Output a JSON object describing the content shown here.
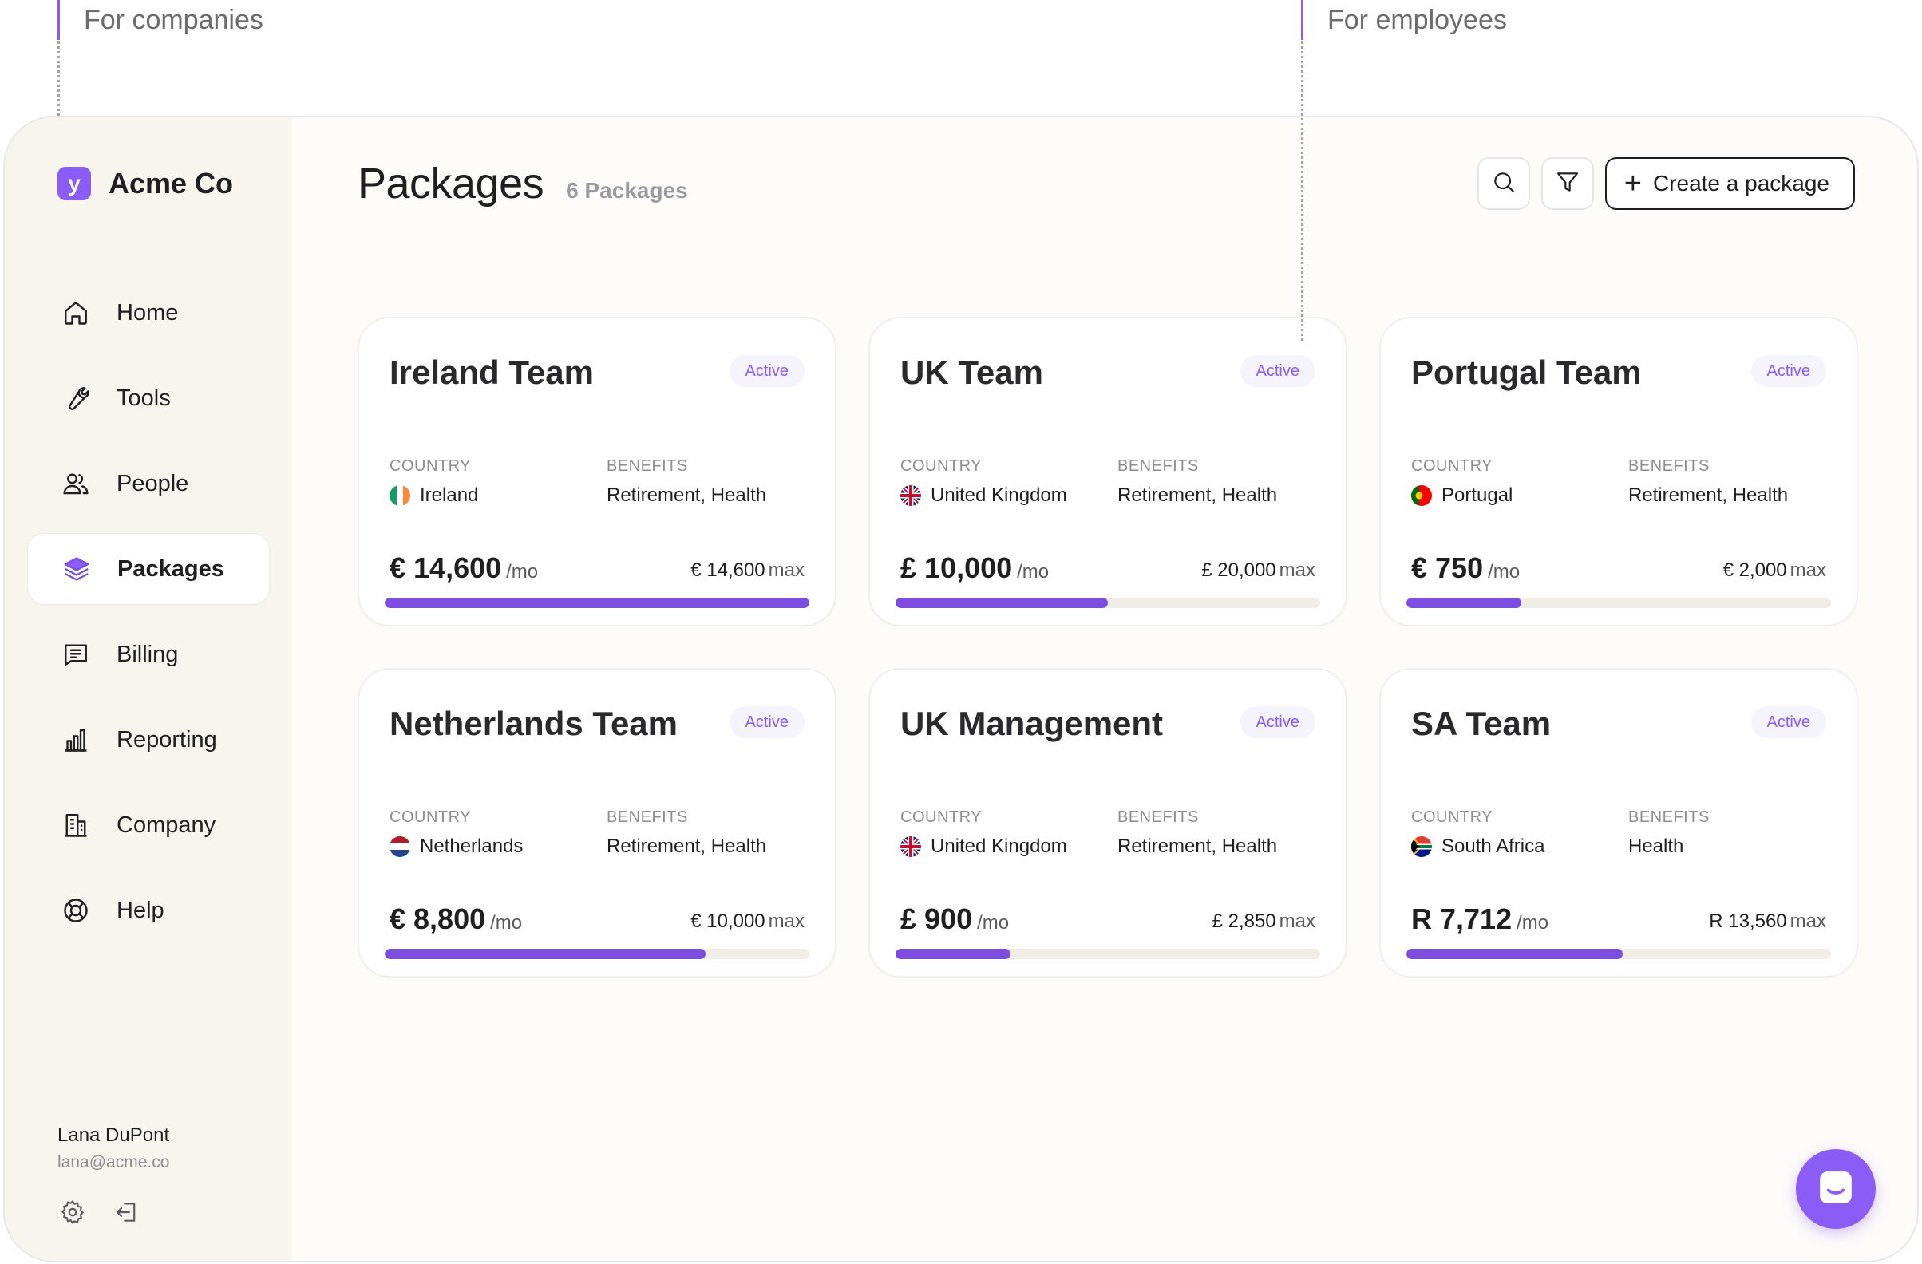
{
  "annotations": {
    "left": "For companies",
    "right": "For employees"
  },
  "brand": {
    "logo_letter": "y",
    "name": "Acme Co"
  },
  "nav": [
    {
      "label": "Home",
      "icon": "home-icon",
      "active": false
    },
    {
      "label": "Tools",
      "icon": "wrench-icon",
      "active": false
    },
    {
      "label": "People",
      "icon": "people-icon",
      "active": false
    },
    {
      "label": "Packages",
      "icon": "layers-icon",
      "active": true
    },
    {
      "label": "Billing",
      "icon": "billing-icon",
      "active": false
    },
    {
      "label": "Reporting",
      "icon": "bar-chart-icon",
      "active": false
    },
    {
      "label": "Company",
      "icon": "building-icon",
      "active": false
    },
    {
      "label": "Help",
      "icon": "lifebuoy-icon",
      "active": false
    }
  ],
  "user": {
    "name": "Lana DuPont",
    "email": "lana@acme.co"
  },
  "header": {
    "title": "Packages",
    "count": "6 Packages",
    "create_label": "Create a package"
  },
  "labels": {
    "country": "COUNTRY",
    "benefits": "BENEFITS",
    "per_month": "/mo",
    "max": "max"
  },
  "packages": [
    {
      "name": "Ireland Team",
      "status": "Active",
      "country": "Ireland",
      "flag": "ireland-flag",
      "benefits": "Retirement, Health",
      "amount": "€ 14,600",
      "max": "€ 14,600",
      "progress": 1.0
    },
    {
      "name": "UK Team",
      "status": "Active",
      "country": "United Kingdom",
      "flag": "uk-flag",
      "benefits": "Retirement, Health",
      "amount": "£ 10,000",
      "max": "£ 20,000",
      "progress": 0.5
    },
    {
      "name": "Portugal Team",
      "status": "Active",
      "country": "Portugal",
      "flag": "portugal-flag",
      "benefits": "Retirement, Health",
      "amount": "€ 750",
      "max": "€ 2,000",
      "progress": 0.27
    },
    {
      "name": "Netherlands Team",
      "status": "Active",
      "country": "Netherlands",
      "flag": "netherlands-flag",
      "benefits": "Retirement, Health",
      "amount": "€ 8,800",
      "max": "€ 10,000",
      "progress": 0.755
    },
    {
      "name": "UK Management",
      "status": "Active",
      "country": "United Kingdom",
      "flag": "uk-flag",
      "benefits": "Retirement, Health",
      "amount": "£ 900",
      "max": "£ 2,850",
      "progress": 0.27
    },
    {
      "name": "SA Team",
      "status": "Active",
      "country": "South Africa",
      "flag": "south-africa-flag",
      "benefits": "Health",
      "amount": "R 7,712",
      "max": "R 13,560",
      "progress": 0.51
    }
  ],
  "colors": {
    "accent": "#8b5cf6",
    "progress": "#7c4ddf",
    "track": "#efede5",
    "sidebar_bg": "#f7f5ee"
  }
}
